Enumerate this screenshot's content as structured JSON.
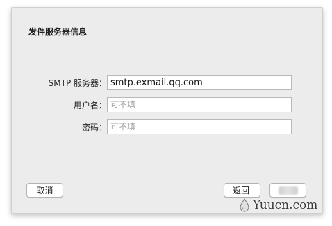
{
  "dialog": {
    "title": "发件服务器信息"
  },
  "form": {
    "smtp": {
      "label": "SMTP 服务器：",
      "value": "smtp.exmail.qq.com",
      "placeholder": ""
    },
    "username": {
      "label": "用户名：",
      "value": "",
      "placeholder": "可不填"
    },
    "password": {
      "label": "密码：",
      "value": "",
      "placeholder": "可不填"
    }
  },
  "buttons": {
    "cancel_label": "取消",
    "back_label": "返回",
    "next_label": ""
  },
  "watermark": {
    "text": "Yuucn.com"
  },
  "colors": {
    "sheet_background": "#ececec",
    "button_background": "#ffffff"
  }
}
